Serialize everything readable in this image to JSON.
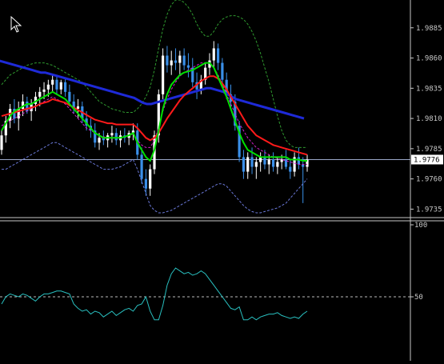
{
  "colors": {
    "background": "#000000",
    "axis": "#c8c8c8",
    "bull_candle": "#ffffff",
    "bear_candle": "#3a8fe8",
    "ma_fast": "#00e000",
    "ma_mid": "#ff1a1a",
    "ma_slow": "#1e2ad8",
    "bands_upper": "#2f9a2f",
    "bands_lower": "#6a78d8",
    "envelope": "#d020c8",
    "oscillator": "#29c0c0",
    "price_line": "#9aa6c8"
  },
  "chart_data": [
    {
      "type": "candlestick",
      "y_ticks": [
        "1.9885",
        "1.9860",
        "1.9835",
        "1.9810",
        "1.9785",
        "1.9760",
        "1.9735"
      ],
      "ylim": [
        1.9728,
        1.9908
      ],
      "current_price": "1.9776",
      "candles": [
        [
          1.9784,
          1.98,
          1.978,
          1.9796
        ],
        [
          1.9796,
          1.9812,
          1.979,
          1.9808
        ],
        [
          1.9808,
          1.9822,
          1.9802,
          1.9818
        ],
        [
          1.9818,
          1.9826,
          1.9806,
          1.981
        ],
        [
          1.981,
          1.9824,
          1.98,
          1.9818
        ],
        [
          1.9818,
          1.983,
          1.9812,
          1.9824
        ],
        [
          1.9824,
          1.9828,
          1.9814,
          1.9816
        ],
        [
          1.9816,
          1.9826,
          1.9808,
          1.9822
        ],
        [
          1.9822,
          1.9832,
          1.9816,
          1.9828
        ],
        [
          1.9828,
          1.9836,
          1.982,
          1.9832
        ],
        [
          1.9832,
          1.984,
          1.9826,
          1.9834
        ],
        [
          1.9834,
          1.9842,
          1.9828,
          1.9838
        ],
        [
          1.9838,
          1.9846,
          1.9832,
          1.9842
        ],
        [
          1.9842,
          1.9846,
          1.983,
          1.9834
        ],
        [
          1.9834,
          1.9842,
          1.983,
          1.984
        ],
        [
          1.984,
          1.9844,
          1.9828,
          1.9832
        ],
        [
          1.9832,
          1.9838,
          1.982,
          1.9824
        ],
        [
          1.9824,
          1.983,
          1.9814,
          1.9818
        ],
        [
          1.9818,
          1.9826,
          1.981,
          1.982
        ],
        [
          1.982,
          1.9824,
          1.9806,
          1.981
        ],
        [
          1.981,
          1.9816,
          1.98,
          1.9804
        ],
        [
          1.9804,
          1.981,
          1.9794,
          1.98
        ],
        [
          1.98,
          1.9806,
          1.9786,
          1.979
        ],
        [
          1.979,
          1.9798,
          1.9784,
          1.9794
        ],
        [
          1.9794,
          1.98,
          1.9788,
          1.9792
        ],
        [
          1.9792,
          1.9798,
          1.9786,
          1.9796
        ],
        [
          1.9796,
          1.9804,
          1.979,
          1.9798
        ],
        [
          1.9798,
          1.9802,
          1.9788,
          1.9792
        ],
        [
          1.9792,
          1.98,
          1.9786,
          1.9796
        ],
        [
          1.9796,
          1.9802,
          1.979,
          1.9794
        ],
        [
          1.9794,
          1.98,
          1.9788,
          1.9798
        ],
        [
          1.9798,
          1.9806,
          1.9792,
          1.98
        ],
        [
          1.98,
          1.9806,
          1.9776,
          1.978
        ],
        [
          1.978,
          1.9786,
          1.9756,
          1.976
        ],
        [
          1.976,
          1.9768,
          1.9746,
          1.9752
        ],
        [
          1.9752,
          1.9772,
          1.9746,
          1.9768
        ],
        [
          1.9768,
          1.98,
          1.9764,
          1.9796
        ],
        [
          1.9796,
          1.9834,
          1.979,
          1.983
        ],
        [
          1.983,
          1.9868,
          1.9826,
          1.9862
        ],
        [
          1.9862,
          1.987,
          1.9848,
          1.9854
        ],
        [
          1.9854,
          1.9866,
          1.9846,
          1.9858
        ],
        [
          1.9858,
          1.9868,
          1.985,
          1.9856
        ],
        [
          1.9856,
          1.9866,
          1.9846,
          1.9862
        ],
        [
          1.9862,
          1.9868,
          1.985,
          1.9854
        ],
        [
          1.9854,
          1.9864,
          1.9844,
          1.9852
        ],
        [
          1.9852,
          1.986,
          1.9836,
          1.984
        ],
        [
          1.984,
          1.9848,
          1.9826,
          1.9834
        ],
        [
          1.9834,
          1.9846,
          1.983,
          1.9842
        ],
        [
          1.9842,
          1.9856,
          1.9838,
          1.9852
        ],
        [
          1.9852,
          1.9864,
          1.9846,
          1.9858
        ],
        [
          1.9858,
          1.9874,
          1.9852,
          1.9868
        ],
        [
          1.9868,
          1.9872,
          1.985,
          1.9856
        ],
        [
          1.9856,
          1.986,
          1.9836,
          1.9842
        ],
        [
          1.9842,
          1.9848,
          1.9826,
          1.983
        ],
        [
          1.983,
          1.9838,
          1.9818,
          1.9824
        ],
        [
          1.9824,
          1.983,
          1.98,
          1.9804
        ],
        [
          1.9804,
          1.9808,
          1.9774,
          1.9778
        ],
        [
          1.9778,
          1.9784,
          1.976,
          1.9766
        ],
        [
          1.9766,
          1.9782,
          1.976,
          1.9778
        ],
        [
          1.9778,
          1.9786,
          1.9764,
          1.977
        ],
        [
          1.977,
          1.9778,
          1.976,
          1.9774
        ],
        [
          1.9774,
          1.9782,
          1.9766,
          1.9778
        ],
        [
          1.9778,
          1.9784,
          1.9768,
          1.9772
        ],
        [
          1.9772,
          1.978,
          1.9764,
          1.9776
        ],
        [
          1.9776,
          1.9782,
          1.9766,
          1.977
        ],
        [
          1.977,
          1.9778,
          1.9764,
          1.9774
        ],
        [
          1.9774,
          1.978,
          1.9768,
          1.9776
        ],
        [
          1.9776,
          1.9784,
          1.9768,
          1.977
        ],
        [
          1.977,
          1.9776,
          1.976,
          1.9766
        ],
        [
          1.9766,
          1.9782,
          1.9762,
          1.9778
        ],
        [
          1.9778,
          1.9786,
          1.9768,
          1.9772
        ],
        [
          1.9772,
          1.9778,
          1.974,
          1.977
        ],
        [
          1.977,
          1.978,
          1.9766,
          1.9776
        ]
      ],
      "ma_fast": [
        1.98,
        1.9806,
        1.9812,
        1.9816,
        1.9818,
        1.982,
        1.9822,
        1.9822,
        1.9824,
        1.9826,
        1.9828,
        1.983,
        1.9832,
        1.983,
        1.9828,
        1.9826,
        1.9822,
        1.9818,
        1.9814,
        1.981,
        1.9806,
        1.9802,
        1.9798,
        1.9796,
        1.9794,
        1.9794,
        1.9794,
        1.9794,
        1.9794,
        1.9795,
        1.9796,
        1.9798,
        1.979,
        1.9784,
        1.9778,
        1.9775,
        1.9784,
        1.98,
        1.9818,
        1.983,
        1.9838,
        1.9842,
        1.9846,
        1.9848,
        1.9849,
        1.985,
        1.9852,
        1.9854,
        1.9856,
        1.9856,
        1.9852,
        1.9844,
        1.9836,
        1.9828,
        1.9818,
        1.9808,
        1.9798,
        1.979,
        1.9784,
        1.9782,
        1.978,
        1.9778,
        1.9778,
        1.9778,
        1.9778,
        1.9778,
        1.9778,
        1.9778,
        1.9776,
        1.9776,
        1.9776,
        1.9775,
        1.9775
      ],
      "ma_mid": [
        1.9812,
        1.9813,
        1.9814,
        1.9815,
        1.9816,
        1.9817,
        1.9818,
        1.9819,
        1.982,
        1.9822,
        1.9823,
        1.9824,
        1.9826,
        1.9825,
        1.9824,
        1.9823,
        1.9821,
        1.9819,
        1.9817,
        1.9815,
        1.9813,
        1.9811,
        1.9809,
        1.9808,
        1.9807,
        1.9806,
        1.9806,
        1.9805,
        1.9805,
        1.9805,
        1.9805,
        1.9805,
        1.9802,
        1.9798,
        1.9794,
        1.9792,
        1.9794,
        1.9798,
        1.9804,
        1.981,
        1.9815,
        1.982,
        1.9825,
        1.9829,
        1.9832,
        1.9835,
        1.9838,
        1.9841,
        1.9843,
        1.9845,
        1.9845,
        1.9843,
        1.9839,
        1.9834,
        1.9828,
        1.9822,
        1.9816,
        1.981,
        1.9804,
        1.98,
        1.9796,
        1.9794,
        1.9792,
        1.979,
        1.9788,
        1.9787,
        1.9786,
        1.9785,
        1.9784,
        1.9783,
        1.9782,
        1.9781,
        1.978
      ],
      "ma_slow": [
        1.9858,
        1.9857,
        1.9856,
        1.9855,
        1.9854,
        1.9853,
        1.9852,
        1.9851,
        1.985,
        1.9849,
        1.9848,
        1.9848,
        1.9847,
        1.9846,
        1.9845,
        1.9844,
        1.9843,
        1.9842,
        1.9841,
        1.984,
        1.9839,
        1.9838,
        1.9837,
        1.9836,
        1.9835,
        1.9834,
        1.9833,
        1.9832,
        1.9831,
        1.983,
        1.9829,
        1.9828,
        1.9827,
        1.9825,
        1.9823,
        1.9822,
        1.9822,
        1.9823,
        1.9824,
        1.9825,
        1.9826,
        1.9827,
        1.9828,
        1.9829,
        1.983,
        1.9831,
        1.9832,
        1.9833,
        1.9834,
        1.9835,
        1.9835,
        1.9834,
        1.9833,
        1.9832,
        1.983,
        1.9828,
        1.9826,
        1.9825,
        1.9824,
        1.9823,
        1.9822,
        1.9821,
        1.982,
        1.9819,
        1.9818,
        1.9817,
        1.9816,
        1.9815,
        1.9814,
        1.9813,
        1.9812,
        1.9811,
        1.981
      ],
      "band_upper": [
        1.9838,
        1.9842,
        1.9846,
        1.9848,
        1.985,
        1.9852,
        1.9854,
        1.9855,
        1.9856,
        1.9856,
        1.9856,
        1.9855,
        1.9854,
        1.9852,
        1.985,
        1.9848,
        1.9846,
        1.9844,
        1.9842,
        1.984,
        1.9836,
        1.9832,
        1.9828,
        1.9824,
        1.9822,
        1.982,
        1.9818,
        1.9817,
        1.9816,
        1.9815,
        1.9815,
        1.9815,
        1.9818,
        1.9822,
        1.9828,
        1.9836,
        1.985,
        1.9868,
        1.9884,
        1.9896,
        1.9904,
        1.9908,
        1.9908,
        1.9906,
        1.9902,
        1.9896,
        1.9888,
        1.9882,
        1.9878,
        1.9878,
        1.9882,
        1.9888,
        1.9892,
        1.9894,
        1.9895,
        1.9895,
        1.9894,
        1.9892,
        1.9888,
        1.9882,
        1.9874,
        1.9864,
        1.9852,
        1.984,
        1.9826,
        1.9812,
        1.98,
        1.9792,
        1.9788,
        1.9786,
        1.9786,
        1.9786,
        1.9786
      ],
      "band_lower": [
        1.9768,
        1.9768,
        1.977,
        1.9772,
        1.9774,
        1.9776,
        1.9778,
        1.978,
        1.9782,
        1.9784,
        1.9786,
        1.9788,
        1.979,
        1.979,
        1.9788,
        1.9786,
        1.9784,
        1.9782,
        1.978,
        1.9778,
        1.9776,
        1.9774,
        1.9772,
        1.977,
        1.9768,
        1.9768,
        1.9768,
        1.9769,
        1.977,
        1.9772,
        1.9774,
        1.9776,
        1.9768,
        1.9758,
        1.9748,
        1.9738,
        1.9734,
        1.9732,
        1.9732,
        1.9733,
        1.9734,
        1.9736,
        1.9738,
        1.974,
        1.9742,
        1.9744,
        1.9746,
        1.9748,
        1.975,
        1.9752,
        1.9754,
        1.9756,
        1.9756,
        1.9754,
        1.975,
        1.9746,
        1.9742,
        1.9738,
        1.9735,
        1.9733,
        1.9732,
        1.9732,
        1.9733,
        1.9734,
        1.9735,
        1.9736,
        1.9738,
        1.974,
        1.9744,
        1.9748,
        1.9752,
        1.9756,
        1.976
      ],
      "envelope": [
        1.9804,
        1.9806,
        1.9808,
        1.981,
        1.9812,
        1.9814,
        1.9816,
        1.9818,
        1.982,
        1.9822,
        1.9824,
        1.9826,
        1.9828,
        1.9826,
        1.9824,
        1.9822,
        1.9818,
        1.9814,
        1.981,
        1.9806,
        1.9802,
        1.98,
        1.9798,
        1.9796,
        1.9795,
        1.9794,
        1.9794,
        1.9794,
        1.9794,
        1.9795,
        1.9796,
        1.9797,
        1.9792,
        1.9788,
        1.9786,
        1.9786,
        1.9792,
        1.9802,
        1.9816,
        1.9826,
        1.9834,
        1.984,
        1.9845,
        1.9848,
        1.985,
        1.9852,
        1.9854,
        1.9856,
        1.9856,
        1.9856,
        1.9852,
        1.9846,
        1.9838,
        1.983,
        1.9822,
        1.9814,
        1.9806,
        1.98,
        1.9794,
        1.979,
        1.9786,
        1.9784,
        1.9782,
        1.978,
        1.9778,
        1.9777,
        1.9776,
        1.9775,
        1.9774,
        1.9773,
        1.9772,
        1.9772,
        1.9772
      ]
    },
    {
      "type": "line",
      "y_ticks": [
        "100",
        "50"
      ],
      "ylim": [
        0,
        100
      ],
      "reference_level": 50,
      "values": [
        45,
        50,
        52,
        51,
        50,
        52,
        51,
        49,
        47,
        50,
        52,
        52,
        53,
        54,
        54,
        53,
        52,
        45,
        42,
        40,
        41,
        38,
        40,
        39,
        36,
        38,
        40,
        37,
        39,
        41,
        42,
        40,
        44,
        45,
        50,
        40,
        34,
        34,
        44,
        58,
        66,
        70,
        68,
        66,
        67,
        65,
        66,
        68,
        66,
        62,
        58,
        54,
        50,
        46,
        42,
        41,
        43,
        34,
        34,
        36,
        34,
        36,
        37,
        38,
        38,
        39,
        37,
        36,
        35,
        36,
        35,
        38,
        40
      ]
    }
  ]
}
